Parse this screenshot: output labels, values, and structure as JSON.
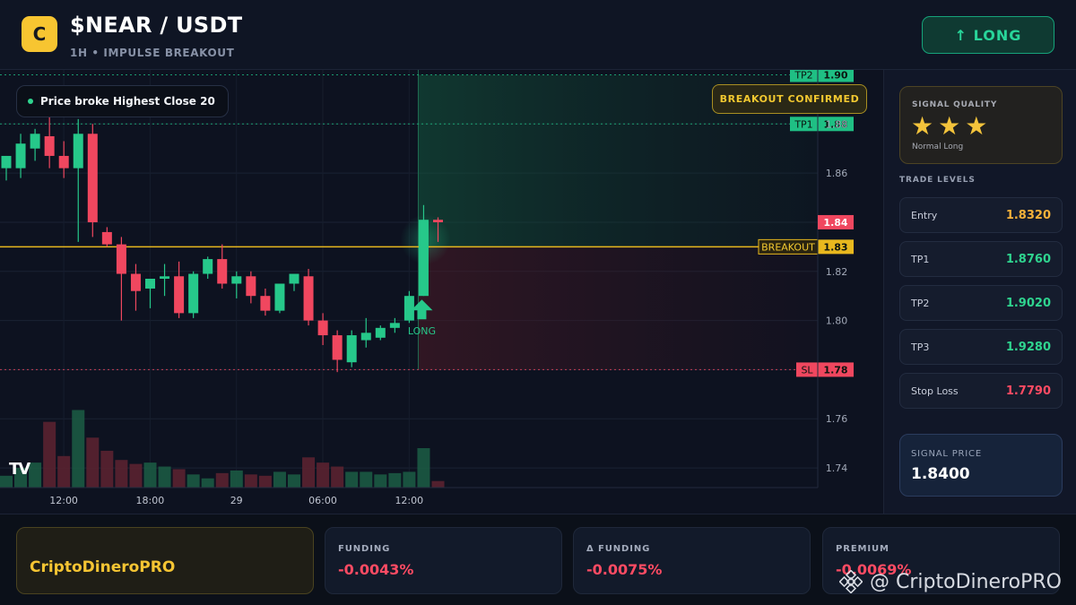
{
  "header": {
    "logo_letter": "C",
    "pair": "$NEAR / USDT",
    "subtitle": "1H • IMPULSE BREAKOUT",
    "signal_button": "↑ LONG"
  },
  "chart": {
    "badge": "Price broke Highest Close 20",
    "confirmed": "BREAKOUT CONFIRMED",
    "signal_marker": "LONG",
    "tv_logo": "TV",
    "levels": [
      {
        "name": "TP2",
        "value": 1.9,
        "label": "1.90",
        "color": "#1fbf84"
      },
      {
        "name": "TP1",
        "value": 1.88,
        "label": "1.88",
        "color": "#1fbf84"
      },
      {
        "name": "BREAKOUT",
        "value": 1.83,
        "label": "1.83",
        "color": "#e8b81e"
      },
      {
        "name": "SL",
        "value": 1.78,
        "label": "1.78",
        "color": "#f0475f"
      }
    ],
    "current_price_label": "1.84",
    "y_ticks": [
      "1.88",
      "1.86",
      "1.82",
      "1.80",
      "1.76",
      "1.74"
    ],
    "x_ticks": [
      "12:00",
      "18:00",
      "29",
      "06:00",
      "12:00"
    ]
  },
  "chart_data": {
    "type": "candlestick",
    "ylim": [
      1.732,
      1.902
    ],
    "candles": [
      {
        "o": 1.862,
        "h": 1.867,
        "l": 1.857,
        "c": 1.867
      },
      {
        "o": 1.862,
        "h": 1.876,
        "l": 1.858,
        "c": 1.872
      },
      {
        "o": 1.87,
        "h": 1.878,
        "l": 1.865,
        "c": 1.876
      },
      {
        "o": 1.875,
        "h": 1.883,
        "l": 1.862,
        "c": 1.867
      },
      {
        "o": 1.867,
        "h": 1.873,
        "l": 1.858,
        "c": 1.862
      },
      {
        "o": 1.862,
        "h": 1.882,
        "l": 1.832,
        "c": 1.876
      },
      {
        "o": 1.876,
        "h": 1.88,
        "l": 1.834,
        "c": 1.84
      },
      {
        "o": 1.836,
        "h": 1.838,
        "l": 1.83,
        "c": 1.831
      },
      {
        "o": 1.831,
        "h": 1.834,
        "l": 1.8,
        "c": 1.819
      },
      {
        "o": 1.819,
        "h": 1.823,
        "l": 1.804,
        "c": 1.812
      },
      {
        "o": 1.813,
        "h": 1.817,
        "l": 1.805,
        "c": 1.817
      },
      {
        "o": 1.817,
        "h": 1.823,
        "l": 1.81,
        "c": 1.818
      },
      {
        "o": 1.818,
        "h": 1.824,
        "l": 1.801,
        "c": 1.803
      },
      {
        "o": 1.803,
        "h": 1.82,
        "l": 1.801,
        "c": 1.819
      },
      {
        "o": 1.819,
        "h": 1.826,
        "l": 1.817,
        "c": 1.825
      },
      {
        "o": 1.825,
        "h": 1.831,
        "l": 1.813,
        "c": 1.815
      },
      {
        "o": 1.815,
        "h": 1.82,
        "l": 1.809,
        "c": 1.818
      },
      {
        "o": 1.818,
        "h": 1.82,
        "l": 1.807,
        "c": 1.81
      },
      {
        "o": 1.81,
        "h": 1.813,
        "l": 1.802,
        "c": 1.804
      },
      {
        "o": 1.804,
        "h": 1.814,
        "l": 1.803,
        "c": 1.815
      },
      {
        "o": 1.815,
        "h": 1.819,
        "l": 1.812,
        "c": 1.819
      },
      {
        "o": 1.818,
        "h": 1.821,
        "l": 1.798,
        "c": 1.8
      },
      {
        "o": 1.8,
        "h": 1.803,
        "l": 1.79,
        "c": 1.794
      },
      {
        "o": 1.794,
        "h": 1.796,
        "l": 1.779,
        "c": 1.784
      },
      {
        "o": 1.783,
        "h": 1.796,
        "l": 1.781,
        "c": 1.794
      },
      {
        "o": 1.792,
        "h": 1.801,
        "l": 1.789,
        "c": 1.795
      },
      {
        "o": 1.793,
        "h": 1.798,
        "l": 1.792,
        "c": 1.797
      },
      {
        "o": 1.797,
        "h": 1.801,
        "l": 1.795,
        "c": 1.799
      },
      {
        "o": 1.8,
        "h": 1.812,
        "l": 1.799,
        "c": 1.81
      },
      {
        "o": 1.81,
        "h": 1.847,
        "l": 1.81,
        "c": 1.841
      },
      {
        "o": 1.841,
        "h": 1.842,
        "l": 1.832,
        "c": 1.84
      }
    ],
    "volume": [
      18,
      30,
      38,
      100,
      48,
      118,
      76,
      56,
      42,
      36,
      38,
      32,
      28,
      20,
      14,
      22,
      26,
      20,
      18,
      24,
      20,
      46,
      38,
      32,
      24,
      24,
      20,
      22,
      24,
      60,
      10
    ],
    "volume_max": 120
  },
  "sidebar": {
    "quality_title": "SIGNAL QUALITY",
    "stars": 3,
    "quality_note": "Normal Long",
    "levels_title": "TRADE LEVELS",
    "levels": [
      {
        "name": "Entry",
        "value": "1.8320",
        "color": "#f5b13a"
      },
      {
        "name": "TP1",
        "value": "1.8760",
        "color": "#2fd48f"
      },
      {
        "name": "TP2",
        "value": "1.9020",
        "color": "#2fd48f"
      },
      {
        "name": "TP3",
        "value": "1.9280",
        "color": "#2fd48f"
      },
      {
        "name": "Stop Loss",
        "value": "1.7790",
        "color": "#ff4b63"
      }
    ],
    "signal_price_title": "SIGNAL PRICE",
    "signal_price": "1.8400"
  },
  "bottom": {
    "brand": "CriptoDineroPRO",
    "stats": [
      {
        "label": "FUNDING",
        "value": "-0.0043%"
      },
      {
        "label": "Δ FUNDING",
        "value": "-0.0075%"
      },
      {
        "label": "PREMIUM",
        "value": "-0.0069%"
      }
    ],
    "watermark": "@ CriptoDineroPRO"
  },
  "colors": {
    "bull": "#26c88a",
    "bear": "#f0475f",
    "gold": "#f2c830"
  }
}
